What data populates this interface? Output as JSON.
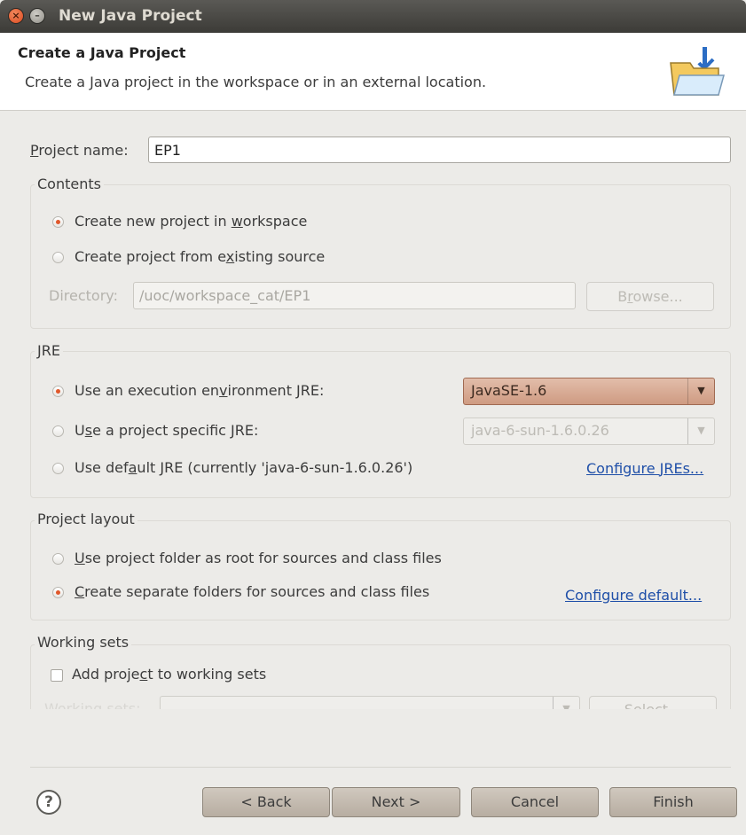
{
  "window": {
    "title": "New Java Project"
  },
  "header": {
    "title": "Create a Java Project",
    "description": "Create a Java project in the workspace or in an external location."
  },
  "project_name": {
    "label_mnemonic": "P",
    "label_rest": "roject name:",
    "value": "EP1"
  },
  "contents": {
    "title": "Contents",
    "option_workspace": {
      "pre": "Create new project in ",
      "mn": "w",
      "post": "orkspace",
      "checked": true
    },
    "option_existing": {
      "pre": "Create project from e",
      "mn": "x",
      "post": "isting source",
      "checked": false
    },
    "directory_label": "Directory:",
    "directory_value": "/uoc/workspace_cat/EP1",
    "browse": {
      "pre": "B",
      "mn": "r",
      "post": "owse..."
    }
  },
  "jre": {
    "title": "JRE",
    "option_exec_env": {
      "pre": "Use an execution en",
      "mn": "v",
      "post": "ironment JRE:",
      "checked": true
    },
    "exec_env_value": "JavaSE-1.6",
    "option_specific": {
      "pre": "U",
      "mn": "s",
      "post": "e a project specific JRE:",
      "checked": false
    },
    "specific_value": "java-6-sun-1.6.0.26",
    "option_default": {
      "pre": "Use def",
      "mn": "a",
      "post": "ult JRE (currently 'java-6-sun-1.6.0.26')",
      "checked": false
    },
    "configure_link": {
      "pre": "Configure ",
      "mn": "J",
      "post": "REs..."
    }
  },
  "layout": {
    "title": "Project layout",
    "option_root": {
      "pre": "",
      "mn": "U",
      "post": "se project folder as root for sources and class files",
      "checked": false
    },
    "option_separate": {
      "pre": "",
      "mn": "C",
      "post": "reate separate folders for sources and class files",
      "checked": true
    },
    "configure_default_link": "Configure default..."
  },
  "working_sets": {
    "title": "Working sets",
    "add_option": {
      "pre": "Add proje",
      "mn": "c",
      "post": "t to working sets",
      "checked": false
    },
    "label": "Working sets:",
    "select": "Select..."
  },
  "buttons": {
    "back": "< Back",
    "next": "Next >",
    "cancel": "Cancel",
    "finish": "Finish",
    "help_glyph": "?"
  },
  "icons": {
    "close": "close-icon",
    "minimize": "minimize-icon",
    "header": "java-project-folder-icon",
    "help": "help-icon"
  }
}
